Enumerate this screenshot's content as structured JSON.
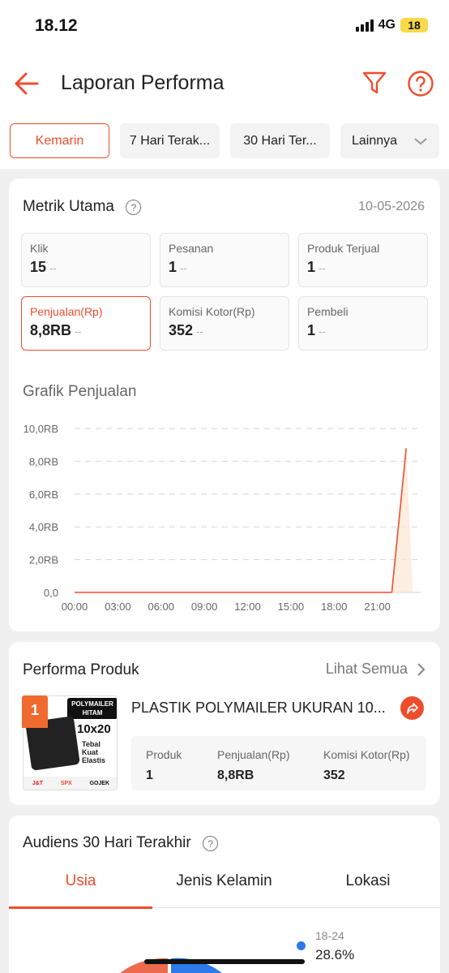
{
  "status": {
    "time": "18.12",
    "network": "4G",
    "battery": "18"
  },
  "header": {
    "title": "Laporan Performa"
  },
  "date_tabs": [
    {
      "label": "Kemarin",
      "active": true
    },
    {
      "label": "7 Hari Terak..."
    },
    {
      "label": "30 Hari Ter..."
    },
    {
      "label": "Lainnya"
    }
  ],
  "metrics": {
    "title": "Metrik Utama",
    "date": "10-05-2026",
    "items": [
      {
        "label": "Klik",
        "value": "15",
        "change": "--"
      },
      {
        "label": "Pesanan",
        "value": "1",
        "change": "--"
      },
      {
        "label": "Produk Terjual",
        "value": "1",
        "change": "--"
      },
      {
        "label": "Penjualan(Rp)",
        "value": "8,8RB",
        "change": "--",
        "active": true
      },
      {
        "label": "Komisi Kotor(Rp)",
        "value": "352",
        "change": "--"
      },
      {
        "label": "Pembeli",
        "value": "1",
        "change": "--"
      }
    ]
  },
  "sales_chart": {
    "title": "Grafik Penjualan"
  },
  "chart_data": {
    "type": "line",
    "title": "Grafik Penjualan",
    "y_ticks": [
      "10,0RB",
      "8,0RB",
      "6,0RB",
      "4,0RB",
      "2,0RB",
      "0,0"
    ],
    "x_ticks": [
      "00:00",
      "03:00",
      "06:00",
      "09:00",
      "12:00",
      "15:00",
      "18:00",
      "21:00"
    ],
    "ylim": [
      0,
      10000
    ],
    "xlim": [
      0,
      24
    ],
    "grid": true,
    "color": "#ee4d2d",
    "series": [
      {
        "x": [
          0,
          22,
          23
        ],
        "y": [
          0,
          0,
          8800
        ]
      }
    ]
  },
  "product_perf": {
    "title": "Performa Produk",
    "see_all": "Lihat Semua",
    "rank": "1",
    "thumb": {
      "brand": "POLYMAILER",
      "brand2": "HITAM",
      "size": "10x20",
      "lines": [
        "Tebal",
        "Kuat",
        "Elastis"
      ],
      "couriers": [
        "J&T",
        "SPX",
        "GOJEK"
      ]
    },
    "name": "PLASTIK POLYMAILER UKURAN 10...",
    "stats": [
      {
        "label": "Produk",
        "value": "1"
      },
      {
        "label": "Penjualan(Rp)",
        "value": "8,8RB"
      },
      {
        "label": "Komisi Kotor(Rp)",
        "value": "352"
      }
    ]
  },
  "audience": {
    "title": "Audiens 30 Hari Terakhir",
    "tabs": [
      "Usia",
      "Jenis Kelamin",
      "Lokasi"
    ],
    "legend": [
      {
        "label": "18-24",
        "value": "28.6%",
        "color": "#2d7ae8"
      }
    ],
    "pie_colors": {
      "a": "#ee6a4d",
      "b": "#2d7ae8"
    }
  }
}
